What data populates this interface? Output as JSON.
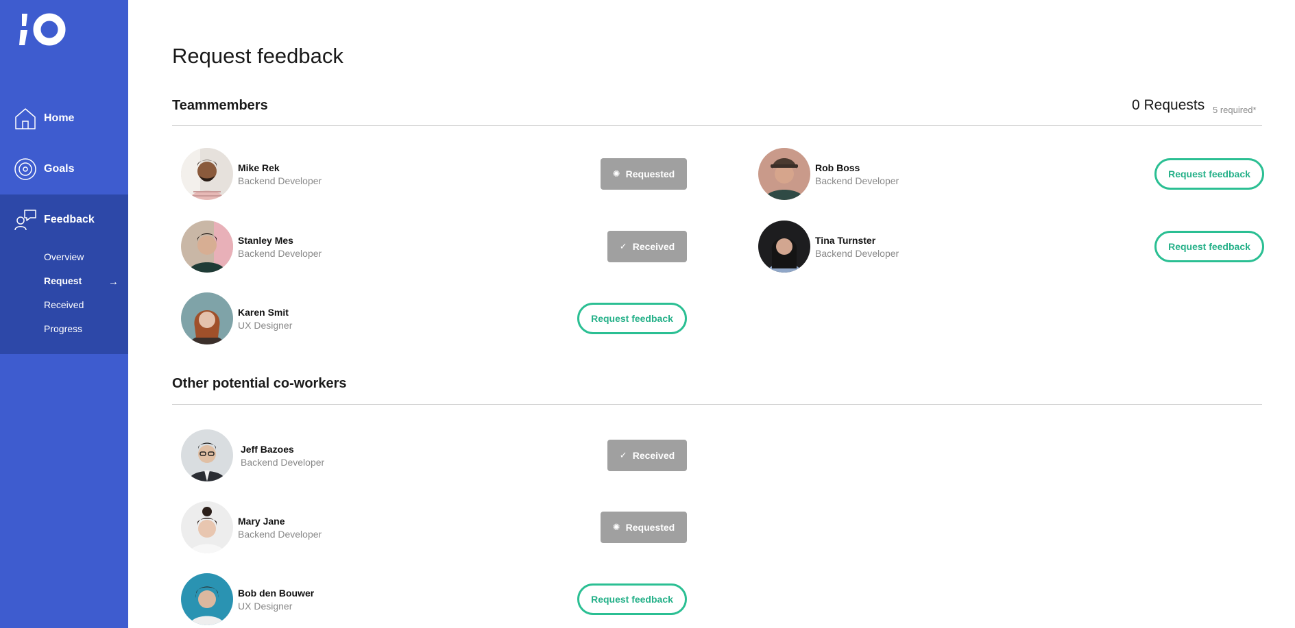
{
  "sidebar": {
    "logo_icon": "io-logo",
    "items": [
      {
        "label": "Home",
        "icon": "home-icon"
      },
      {
        "label": "Goals",
        "icon": "target-icon"
      },
      {
        "label": "Feedback",
        "icon": "feedback-icon"
      }
    ],
    "feedback_subitems": [
      {
        "label": "Overview",
        "active": false
      },
      {
        "label": "Request",
        "active": true
      },
      {
        "label": "Received",
        "active": false
      },
      {
        "label": "Progress",
        "active": false
      }
    ],
    "active_arrow": "→",
    "colors": {
      "background": "#3e5ccf",
      "active_background": "#2d48a8"
    }
  },
  "page": {
    "title": "Request feedback",
    "teammembers_title": "Teammembers",
    "requests_count": "0 Requests",
    "requests_required": "5 required*",
    "others_title": "Other potential co-workers"
  },
  "labels": {
    "requested": "Requested",
    "received": "Received",
    "request_feedback": "Request feedback"
  },
  "teammembers": [
    {
      "name": "Mike Rek",
      "role": "Backend Developer",
      "status": "requested"
    },
    {
      "name": "Rob Boss",
      "role": "Backend Developer",
      "status": "request"
    },
    {
      "name": "Stanley Mes",
      "role": "Backend Developer",
      "status": "received"
    },
    {
      "name": "Tina Turnster",
      "role": "Backend Developer",
      "status": "request"
    },
    {
      "name": "Karen Smit",
      "role": "UX Designer",
      "status": "request"
    }
  ],
  "others": [
    {
      "name": "Jeff Bazoes",
      "role": "Backend Developer",
      "status": "received"
    },
    {
      "name": "Mary Jane",
      "role": "Backend Developer",
      "status": "requested"
    },
    {
      "name": "Bob den Bouwer",
      "role": "UX Designer",
      "status": "request"
    }
  ],
  "colors": {
    "accent_green": "#2bbf93",
    "status_gray": "#a0a0a0"
  }
}
